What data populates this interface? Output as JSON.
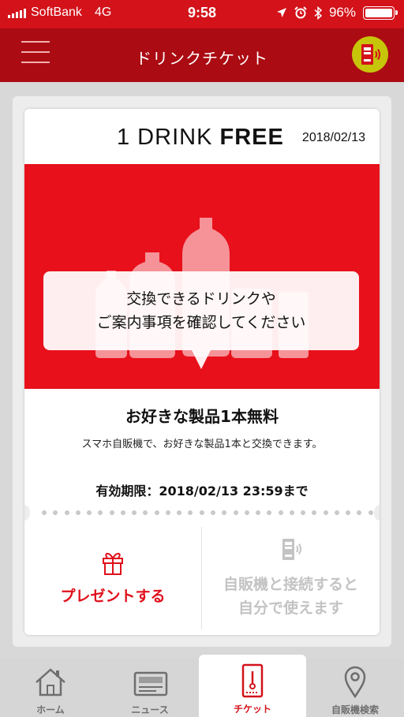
{
  "status_bar": {
    "carrier": "SoftBank",
    "network": "4G",
    "time": "9:58",
    "battery": "96%"
  },
  "nav": {
    "title": "ドリンクチケット"
  },
  "ticket": {
    "title_prefix": "1 DRINK",
    "title_bold": "FREE",
    "date": "2018/02/13",
    "bubble_line1": "交換できるドリンクや",
    "bubble_line2": "ご案内事項を確認してください",
    "product_title": "お好きな製品1本無料",
    "product_desc": "スマホ自販機で、お好きな製品1本と交換できます。",
    "expiry": "有効期限：2018/02/13 23:59まで",
    "present_label": "プレゼントする",
    "connect_line1": "自販機と接続すると",
    "connect_line2": "自分で使えます"
  },
  "tabs": [
    {
      "label": "ホーム",
      "icon": "home-icon"
    },
    {
      "label": "ニュース",
      "icon": "news-icon"
    },
    {
      "label": "チケット",
      "icon": "ticket-icon"
    },
    {
      "label": "自販機検索",
      "icon": "map-pin-icon"
    }
  ],
  "colors": {
    "brand_red": "#d3121a",
    "nav_red": "#ab0b12",
    "ticket_red": "#e8101b",
    "accent_yellow": "#c6c50a",
    "disabled_gray": "#c3c3c3"
  }
}
